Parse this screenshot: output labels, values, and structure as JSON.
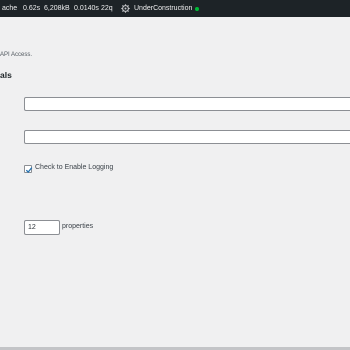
{
  "admin_bar": {
    "cache_label": "ache",
    "load_time": "0.62s",
    "memory": "6,208kB",
    "query_time": "0.0140s",
    "queries": "22q",
    "site_name": "UnderConstruction",
    "status_color": "#00ba37"
  },
  "page": {
    "intro_text": "API Access.",
    "section_heading": "als"
  },
  "fields": {
    "field_1_value": "",
    "field_2_value": "",
    "logging_label": "Check to Enable Logging",
    "logging_checked": true,
    "properties_value": "12",
    "properties_suffix": "properties"
  },
  "icons": {
    "site_icon": "gear-icon",
    "status_icon": "green-dot-icon",
    "checkbox_icon": "checkmark-icon"
  }
}
